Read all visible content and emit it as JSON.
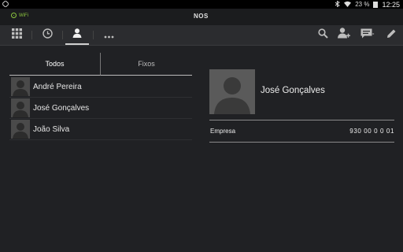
{
  "status_bar": {
    "battery": "23 %",
    "time": "12:25"
  },
  "app_bar": {
    "wifi_label": "WiFi",
    "logo": "NOS"
  },
  "toolbar": {
    "left_icons": [
      "grid-icon",
      "clock-icon",
      "person-icon",
      "more-icon"
    ],
    "selected": "person-icon",
    "right_icons": [
      "search-icon",
      "add-contact-icon",
      "message-icon",
      "edit-icon"
    ]
  },
  "tabs": [
    {
      "label": "Todos",
      "active": true
    },
    {
      "label": "Fixos",
      "active": false
    }
  ],
  "contacts": [
    {
      "name": "André Pereira"
    },
    {
      "name": "José Gonçalves"
    },
    {
      "name": "João Silva"
    }
  ],
  "detail": {
    "name": "José Gonçalves",
    "field_label": "Empresa",
    "field_value": "930 00 0 0 01"
  }
}
